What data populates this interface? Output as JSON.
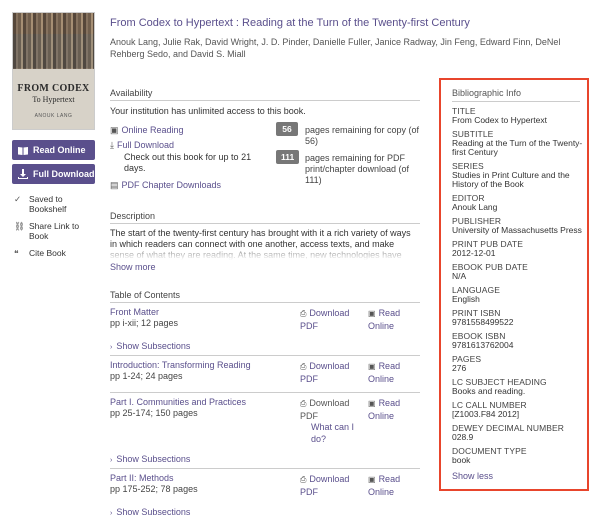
{
  "book": {
    "title": "From Codex to Hypertext : Reading at the Turn of the Twenty-first Century",
    "authors": "Anouk Lang, Julie Rak, David Wright, J. D. Pinder, Danielle Fuller, Janice Radway, Jin Feng, Edward Finn, DeNel Rehberg Sedo, and David S. Miall",
    "cover": {
      "line1": "FROM CODEX",
      "line2": "To Hypertext",
      "line3": "ANOUK LANG"
    }
  },
  "sidebar": {
    "read_online": "Read Online",
    "full_download": "Full Download",
    "saved_to_bookshelf": "Saved to Bookshelf",
    "share_link": "Share Link to Book",
    "cite_book": "Cite Book"
  },
  "availability": {
    "heading": "Availability",
    "access_note": "Your institution has unlimited access to this book.",
    "online_reading": "Online Reading",
    "full_download": "Full Download",
    "checkout_note": "Check out this book for up to 21 days.",
    "pdf_chapter_downloads": "PDF Chapter Downloads",
    "copy_count": "56",
    "copy_text": "pages remaining for copy (of 56)",
    "print_count": "111",
    "print_text": "pages remaining for PDF print/chapter download (of 111)"
  },
  "description": {
    "heading": "Description",
    "text": "The start of the twenty-first century has brought with it a rich variety of ways in which readers can connect with one another, access texts, and make sense of what they are reading. At the same time, new technologies have",
    "show_more": "Show more"
  },
  "toc": {
    "heading": "Table of Contents",
    "download_label": "Download PDF",
    "read_label": "Read Online",
    "show_subsections": "Show Subsections",
    "what_can_i_do": "What can I do?",
    "rows": [
      {
        "name": "Front Matter",
        "pages": "pp i-xii; 12 pages"
      },
      {
        "name": "Introduction: Transforming Reading",
        "pages": "pp 1-24; 24 pages"
      },
      {
        "name": "Part I. Communities and Practices",
        "pages": "pp 25-174; 150 pages"
      },
      {
        "name": "Part II: Methods",
        "pages": "pp 175-252; 78 pages"
      }
    ]
  },
  "biblio": {
    "heading": "Bibliographic Info",
    "fields": [
      {
        "label": "TITLE",
        "value": "From Codex to Hypertext"
      },
      {
        "label": "SUBTITLE",
        "value": "Reading at the Turn of the Twenty-first Century"
      },
      {
        "label": "SERIES",
        "value": "Studies in Print Culture and the History of the Book"
      },
      {
        "label": "EDITOR",
        "value": "Anouk Lang"
      },
      {
        "label": "PUBLISHER",
        "value": "University of Massachusetts Press"
      },
      {
        "label": "PRINT PUB DATE",
        "value": "2012-12-01"
      },
      {
        "label": "EBOOK PUB DATE",
        "value": "N/A"
      },
      {
        "label": "LANGUAGE",
        "value": "English"
      },
      {
        "label": "PRINT ISBN",
        "value": "9781558499522"
      },
      {
        "label": "EBOOK ISBN",
        "value": "9781613762004"
      },
      {
        "label": "PAGES",
        "value": "276"
      },
      {
        "label": "LC SUBJECT HEADING",
        "value": "Books and reading."
      },
      {
        "label": "LC CALL NUMBER",
        "value": "[Z1003.F84 2012]"
      },
      {
        "label": "DEWEY DECIMAL NUMBER",
        "value": "028.9"
      },
      {
        "label": "DOCUMENT TYPE",
        "value": "book"
      }
    ],
    "show_less": "Show less"
  },
  "colors": {
    "accent": "#5a4f8c",
    "highlight_border": "#e8452c",
    "badge": "#777777"
  }
}
